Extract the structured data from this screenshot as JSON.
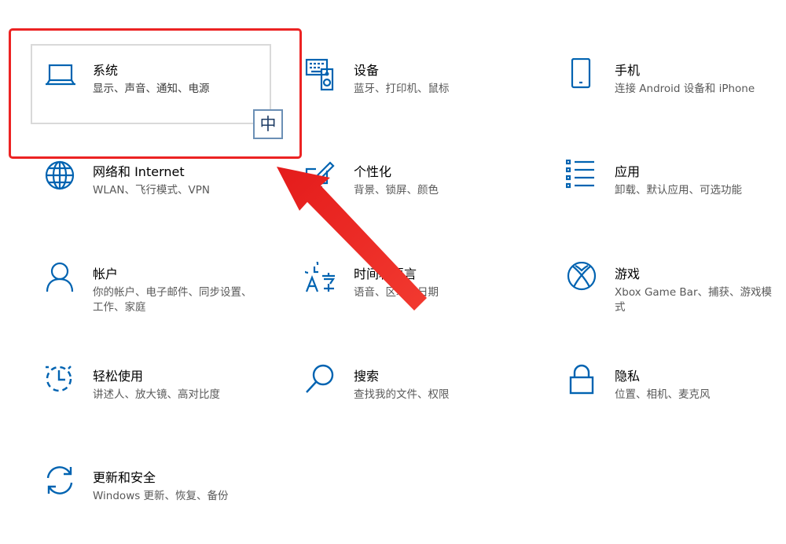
{
  "settings": {
    "items": [
      {
        "id": "system",
        "icon": "laptop-icon",
        "title": "系统",
        "desc": "显示、声音、通知、电源"
      },
      {
        "id": "devices",
        "icon": "keyboard-speaker-icon",
        "title": "设备",
        "desc": "蓝牙、打印机、鼠标"
      },
      {
        "id": "phone",
        "icon": "phone-icon",
        "title": "手机",
        "desc": "连接 Android 设备和 iPhone"
      },
      {
        "id": "network",
        "icon": "globe-icon",
        "title": "网络和 Internet",
        "desc": "WLAN、飞行模式、VPN"
      },
      {
        "id": "personalization",
        "icon": "paint-brush-icon",
        "title": "个性化",
        "desc": "背景、锁屏、颜色"
      },
      {
        "id": "apps",
        "icon": "apps-list-icon",
        "title": "应用",
        "desc": "卸载、默认应用、可选功能"
      },
      {
        "id": "accounts",
        "icon": "person-icon",
        "title": "帐户",
        "desc": "你的帐户、电子邮件、同步设置、工作、家庭"
      },
      {
        "id": "time",
        "icon": "time-language-icon",
        "title": "时间和语言",
        "desc": "语音、区域、日期"
      },
      {
        "id": "gaming",
        "icon": "xbox-icon",
        "title": "游戏",
        "desc": "Xbox Game Bar、捕获、游戏模式"
      },
      {
        "id": "ease",
        "icon": "ease-of-access-icon",
        "title": "轻松使用",
        "desc": "讲述人、放大镜、高对比度"
      },
      {
        "id": "search",
        "icon": "magnifier-icon",
        "title": "搜索",
        "desc": "查找我的文件、权限"
      },
      {
        "id": "privacy",
        "icon": "lock-icon",
        "title": "隐私",
        "desc": "位置、相机、麦克风"
      },
      {
        "id": "update",
        "icon": "sync-icon",
        "title": "更新和安全",
        "desc": "Windows 更新、恢复、备份"
      }
    ]
  },
  "ime": {
    "label": "中"
  },
  "colors": {
    "accent": "#0063b1",
    "annotation": "#ec2323"
  }
}
